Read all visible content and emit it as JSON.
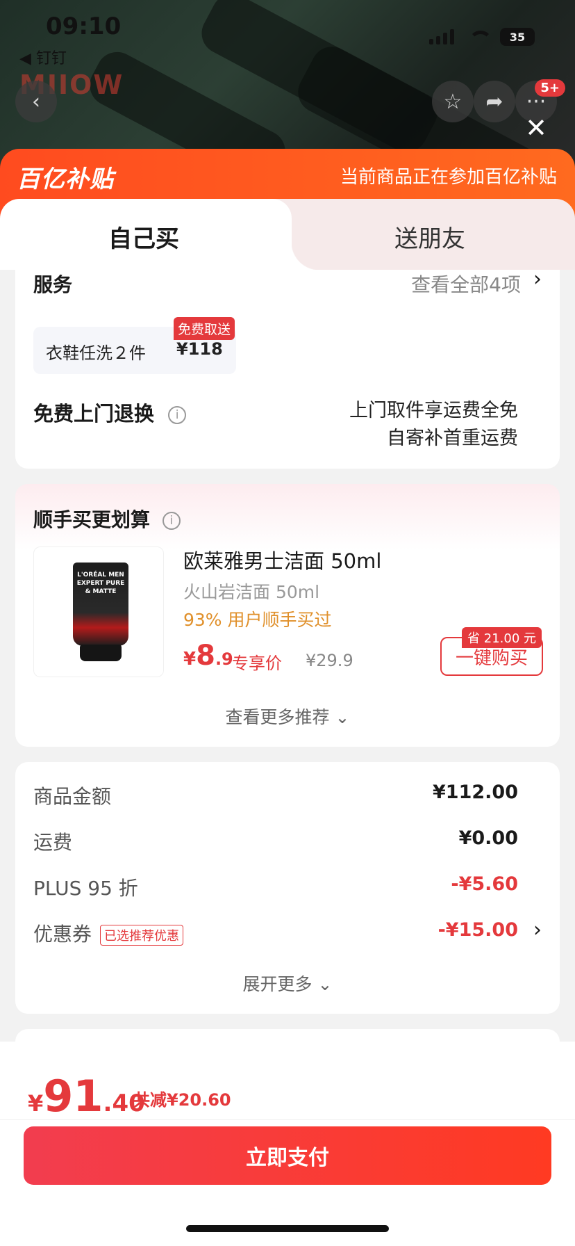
{
  "status_bar": {
    "time": "09:10",
    "back_app": "◀ 钉钉",
    "battery": "35"
  },
  "backdrop": {
    "brand_logo": "MIIOW",
    "cart_badge": "5+"
  },
  "banner": {
    "logo": "百亿补贴",
    "message": "当前商品正在参加百亿补贴"
  },
  "tabs": [
    {
      "label": "自己买",
      "active": true
    },
    {
      "label": "送朋友",
      "active": false
    }
  ],
  "service": {
    "title": "服务",
    "view_all": "查看全部4项",
    "chip_name": "衣鞋任洗２件",
    "chip_price": "¥118",
    "chip_badge": "免费取送",
    "return_title": "免费上门退换",
    "return_line1": "上门取件享运费全免",
    "return_line2": "自寄补首重运费"
  },
  "addon": {
    "title": "顺手买更划算",
    "product_name": "欧莱雅男士洁面 50ml",
    "product_sub": "火山岩洁面 50ml",
    "product_pct": "93% 用户顺手买过",
    "price_currency": "¥",
    "price_int": "8",
    "price_dec": ".9",
    "price_label": "专享价",
    "price_original": "¥29.9",
    "buy_label": "一键购买",
    "save_badge": "省 21.00 元",
    "more_rec": "查看更多推荐 ⌄",
    "tube_text": "L'ORÉAL MEN EXPERT PURE & MATTE"
  },
  "summary": {
    "rows": [
      {
        "label": "商品金额",
        "value": "¥112.00"
      },
      {
        "label": "运费",
        "value": "¥0.00"
      },
      {
        "label": "PLUS 95 折",
        "value": "-¥5.60"
      },
      {
        "label": "优惠券",
        "value": "-¥15.00",
        "tag": "已选推荐优惠"
      }
    ],
    "expand": "展开更多 ⌄"
  },
  "bottom": {
    "total_currency": "¥",
    "total_int": "91",
    "total_dec": ".40",
    "total_saved": "共减¥20.60",
    "pay_label": "立即支付"
  },
  "colors": {
    "accent_red": "#e4393c",
    "banner_orange": "#ff5a1f",
    "highlight_orange": "#e0902b"
  }
}
